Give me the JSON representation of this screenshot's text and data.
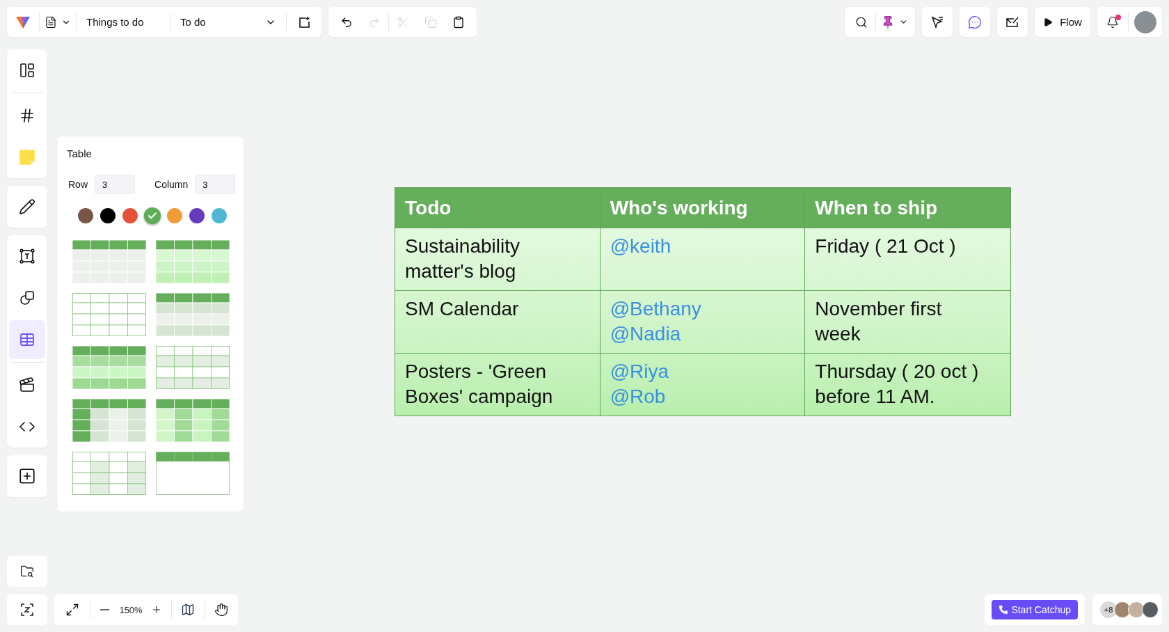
{
  "toolbar": {
    "doc_name": "Things to do",
    "page": "To do"
  },
  "edit_actions": [
    {
      "disabled": false
    },
    {
      "disabled": true
    },
    {
      "disabled": true
    },
    {
      "disabled": true
    },
    {
      "disabled": false
    }
  ],
  "flow_button": "Flow",
  "notifications": {
    "unread": true
  },
  "sidebar": {
    "groups": [
      {
        "items": [
          {
            "selected": false
          },
          {
            "selected": false
          },
          {
            "selected": false
          }
        ]
      },
      {
        "items": [
          {
            "selected": false
          }
        ]
      },
      {
        "items": [
          {
            "selected": false
          },
          {
            "selected": false
          },
          {
            "selected": true
          },
          {
            "selected": false
          },
          {
            "selected": false
          }
        ]
      },
      {
        "items": [
          {
            "selected": false
          }
        ]
      }
    ]
  },
  "table_panel": {
    "title": "Table",
    "row_label": "Row",
    "row_value": "3",
    "column_label": "Column",
    "column_value": "3",
    "colors": [
      {
        "color": "#7a5646",
        "selected": false
      },
      {
        "color": "#000000",
        "selected": false
      },
      {
        "color": "#e4513a",
        "selected": false
      },
      {
        "color": "#5fad56",
        "selected": true
      },
      {
        "color": "#f19c38",
        "selected": false
      },
      {
        "color": "#653bb9",
        "selected": false
      },
      {
        "color": "#4fb8d4",
        "selected": false
      }
    ],
    "templates": [
      {
        "kind": "tinted"
      },
      {
        "kind": "gradient"
      },
      {
        "kind": "lined"
      },
      {
        "kind": "banded"
      },
      {
        "kind": "shaded"
      },
      {
        "kind": "alternating"
      },
      {
        "kind": "sidebar"
      },
      {
        "kind": "columns"
      },
      {
        "kind": "striped"
      },
      {
        "kind": "plain"
      }
    ]
  },
  "zoom": {
    "value": "150%"
  },
  "table": {
    "columns": [
      "Todo",
      "Who's working",
      "When to ship"
    ],
    "rows": [
      {
        "cells": [
          {
            "kind": "text",
            "lines": [
              "Sustainability",
              "matter's blog"
            ]
          },
          {
            "kind": "mention",
            "lines": [
              "@keith"
            ]
          },
          {
            "kind": "text",
            "lines": [
              "Friday ( 21 Oct )"
            ]
          }
        ]
      },
      {
        "cells": [
          {
            "kind": "text",
            "lines": [
              "SM Calendar"
            ]
          },
          {
            "kind": "mention",
            "lines": [
              "@Bethany",
              "@Nadia"
            ]
          },
          {
            "kind": "text",
            "lines": [
              "November first",
              "week"
            ]
          }
        ]
      },
      {
        "cells": [
          {
            "kind": "text",
            "lines": [
              "Posters - 'Green",
              "Boxes' campaign"
            ]
          },
          {
            "kind": "mention",
            "lines": [
              "@Riya",
              "@Rob"
            ]
          },
          {
            "kind": "text",
            "lines": [
              "Thursday ( 20 oct )",
              "before 11 AM."
            ]
          }
        ]
      }
    ]
  },
  "catchup_button": "Start Catchup",
  "collaborators": {
    "extra": "+8"
  }
}
